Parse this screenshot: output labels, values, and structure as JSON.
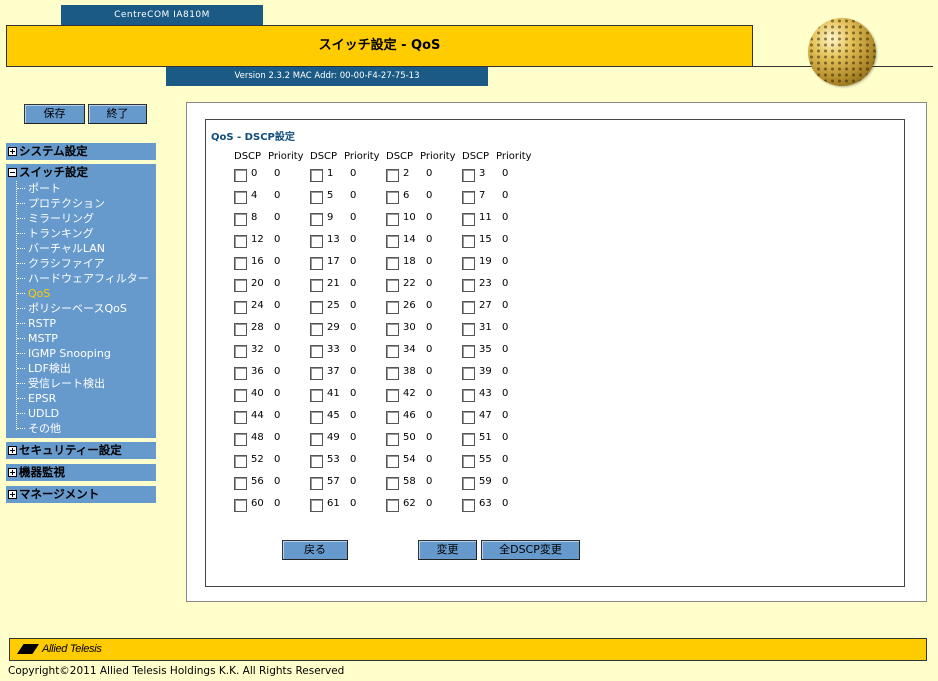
{
  "header": {
    "model": "CentreCOM IA810M",
    "title": "スイッチ設定 - QoS",
    "version": "Version 2.3.2 MAC Addr: 00-00-F4-27-75-13"
  },
  "toolbar": {
    "save_label": "保存",
    "exit_label": "終了"
  },
  "sidebar": {
    "system": "システム設定",
    "switch": "スイッチ設定",
    "switch_items": [
      "ポート",
      "プロテクション",
      "ミラーリング",
      "トランキング",
      "バーチャルLAN",
      "クラシファイア",
      "ハードウェアフィルター",
      "QoS",
      "ポリシーベースQoS",
      "RSTP",
      "MSTP",
      "IGMP Snooping",
      "LDF検出",
      "受信レート検出",
      "EPSR",
      "UDLD",
      "その他"
    ],
    "active_item": "QoS",
    "security": "セキュリティー設定",
    "monitor": "機器監視",
    "management": "マネージメント"
  },
  "main": {
    "section_title": "QoS - DSCP設定",
    "col_dscp": "DSCP",
    "col_priority": "Priority",
    "priorities": [
      0,
      0,
      0,
      0,
      0,
      0,
      0,
      0,
      0,
      0,
      0,
      0,
      0,
      0,
      0,
      0,
      0,
      0,
      0,
      0,
      0,
      0,
      0,
      0,
      0,
      0,
      0,
      0,
      0,
      0,
      0,
      0,
      0,
      0,
      0,
      0,
      0,
      0,
      0,
      0,
      0,
      0,
      0,
      0,
      0,
      0,
      0,
      0,
      0,
      0,
      0,
      0,
      0,
      0,
      0,
      0,
      0,
      0,
      0,
      0,
      0,
      0,
      0,
      0
    ],
    "back_label": "戻る",
    "change_label": "変更",
    "all_change_label": "全DSCP変更"
  },
  "footer": {
    "logo_text": "Allied Telesis",
    "copyright": "Copyright©2011 Allied Telesis Holdings K.K. All Rights Reserved"
  },
  "colors": {
    "accent_yellow": "#ffcc00",
    "nav_blue": "#6699cc",
    "header_blue": "#1a5a85",
    "background": "#ffffcc"
  }
}
